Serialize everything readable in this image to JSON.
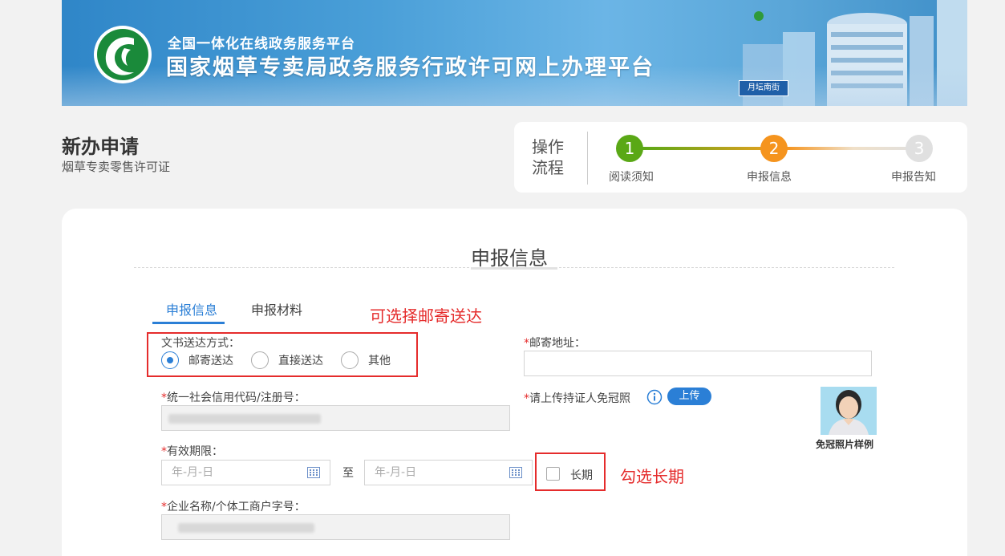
{
  "banner": {
    "subtitle": "全国一体化在线政务服务平台",
    "title": "国家烟草专卖局政务服务行政许可网上办理平台",
    "street_sign": "月坛南街"
  },
  "page": {
    "title": "新办申请",
    "subtitle": "烟草专卖零售许可证"
  },
  "process": {
    "label": "操作流程",
    "steps": [
      {
        "number": "1",
        "label": "阅读须知",
        "status": "done",
        "color": "#5aa816"
      },
      {
        "number": "2",
        "label": "申报信息",
        "status": "active",
        "color": "#f5941e"
      },
      {
        "number": "3",
        "label": "申报告知",
        "status": "pending",
        "color": "#e0e0e0"
      }
    ]
  },
  "form": {
    "section_title": "申报信息",
    "tabs": [
      {
        "label": "申报信息",
        "active": true
      },
      {
        "label": "申报材料",
        "active": false
      }
    ],
    "delivery": {
      "label": "文书送达方式：",
      "options": [
        "邮寄送达",
        "直接送达",
        "其他"
      ],
      "selected": "邮寄送达"
    },
    "mail_address": {
      "required_mark": "*",
      "label": "邮寄地址：",
      "value": ""
    },
    "credit_code": {
      "required_mark": "*",
      "label": "统一社会信用代码/注册号："
    },
    "photo_upload": {
      "required_mark": "*",
      "label": "请上传持证人免冠照",
      "button": "上传",
      "sample_caption": "免冠照片样例"
    },
    "validity": {
      "required_mark": "*",
      "label": "有效期限：",
      "start_placeholder": "年-月-日",
      "separator": "至",
      "end_placeholder": "年-月-日",
      "long_term_label": "长期",
      "long_term_checked": false
    },
    "company_name": {
      "required_mark": "*",
      "label": "企业名称/个体工商户字号："
    }
  },
  "annotations": {
    "note_delivery": "可选择邮寄送达",
    "note_long_term": "勾选长期"
  },
  "colors": {
    "accent": "#2b7fd6",
    "annotation": "#e52c2c",
    "banner": "#4a9fd8"
  }
}
